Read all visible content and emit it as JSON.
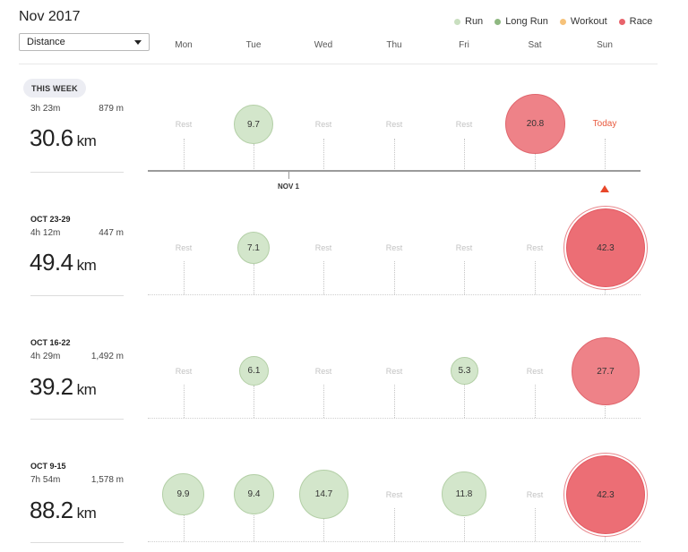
{
  "header": {
    "month": "Nov 2017",
    "metric_select": {
      "selected": "Distance"
    }
  },
  "legend": [
    {
      "label": "Run",
      "color": "#c9dfc0"
    },
    {
      "label": "Long Run",
      "color": "#8fb881"
    },
    {
      "label": "Workout",
      "color": "#f6c27a"
    },
    {
      "label": "Race",
      "color": "#e8636b"
    }
  ],
  "days": [
    "Mon",
    "Tue",
    "Wed",
    "Thu",
    "Fri",
    "Sat",
    "Sun"
  ],
  "rest_text": "Rest",
  "today_text": "Today",
  "nov1_label": "NOV 1",
  "weeks": [
    {
      "label": "THIS WEEK",
      "time": "3h 23m",
      "elevation": "879 m",
      "distance": "30.6",
      "unit": "km",
      "days": [
        {
          "type": "rest"
        },
        {
          "type": "run",
          "value": "9.7"
        },
        {
          "type": "rest"
        },
        {
          "type": "rest"
        },
        {
          "type": "rest"
        },
        {
          "type": "race",
          "value": "20.8"
        },
        {
          "type": "today"
        }
      ]
    },
    {
      "label": "OCT 23-29",
      "time": "4h 12m",
      "elevation": "447 m",
      "distance": "49.4",
      "unit": "km",
      "days": [
        {
          "type": "rest"
        },
        {
          "type": "run",
          "value": "7.1"
        },
        {
          "type": "rest"
        },
        {
          "type": "rest"
        },
        {
          "type": "rest"
        },
        {
          "type": "rest"
        },
        {
          "type": "race",
          "value": "42.3"
        }
      ]
    },
    {
      "label": "OCT 16-22",
      "time": "4h 29m",
      "elevation": "1,492 m",
      "distance": "39.2",
      "unit": "km",
      "days": [
        {
          "type": "rest"
        },
        {
          "type": "run",
          "value": "6.1"
        },
        {
          "type": "rest"
        },
        {
          "type": "rest"
        },
        {
          "type": "run",
          "value": "5.3"
        },
        {
          "type": "rest"
        },
        {
          "type": "race",
          "value": "27.7"
        }
      ]
    },
    {
      "label": "OCT 9-15",
      "time": "7h 54m",
      "elevation": "1,578 m",
      "distance": "88.2",
      "unit": "km",
      "days": [
        {
          "type": "run",
          "value": "9.9"
        },
        {
          "type": "run",
          "value": "9.4"
        },
        {
          "type": "run",
          "value": "14.7"
        },
        {
          "type": "rest"
        },
        {
          "type": "run",
          "value": "11.8"
        },
        {
          "type": "rest"
        },
        {
          "type": "race",
          "value": "42.3"
        }
      ]
    }
  ]
}
